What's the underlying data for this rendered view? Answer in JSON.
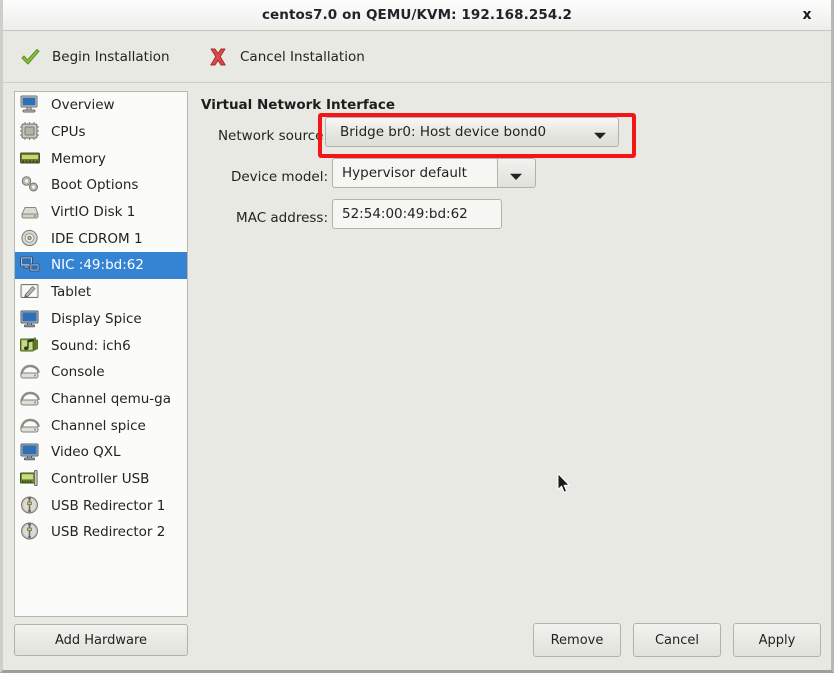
{
  "window": {
    "title": "centos7.0 on QEMU/KVM: 192.168.254.2",
    "close_label": "x"
  },
  "toolbar": {
    "items": [
      {
        "label": "Begin Installation",
        "icon": "check-icon"
      },
      {
        "label": "Cancel Installation",
        "icon": "x-mark-icon"
      }
    ]
  },
  "sidebar": {
    "items": [
      {
        "label": "Overview",
        "icon": "monitor-icon",
        "selected": false
      },
      {
        "label": "CPUs",
        "icon": "cpu-chip-icon",
        "selected": false
      },
      {
        "label": "Memory",
        "icon": "memory-icon",
        "selected": false
      },
      {
        "label": "Boot Options",
        "icon": "gears-icon",
        "selected": false
      },
      {
        "label": "VirtIO Disk 1",
        "icon": "hard-disk-icon",
        "selected": false
      },
      {
        "label": "IDE CDROM 1",
        "icon": "cdrom-icon",
        "selected": false
      },
      {
        "label": "NIC :49:bd:62",
        "icon": "network-card-icon",
        "selected": true
      },
      {
        "label": "Tablet",
        "icon": "tablet-pen-icon",
        "selected": false
      },
      {
        "label": "Display Spice",
        "icon": "display-icon",
        "selected": false
      },
      {
        "label": "Sound: ich6",
        "icon": "sound-note-icon",
        "selected": false
      },
      {
        "label": "Console",
        "icon": "console-icon",
        "selected": false
      },
      {
        "label": "Channel qemu-ga",
        "icon": "console-icon",
        "selected": false
      },
      {
        "label": "Channel spice",
        "icon": "console-icon",
        "selected": false
      },
      {
        "label": "Video QXL",
        "icon": "display-icon",
        "selected": false
      },
      {
        "label": "Controller USB",
        "icon": "controller-card-icon",
        "selected": false
      },
      {
        "label": "USB Redirector 1",
        "icon": "usb-icon",
        "selected": false
      },
      {
        "label": "USB Redirector 2",
        "icon": "usb-icon",
        "selected": false
      }
    ],
    "add_hardware_label": "Add Hardware"
  },
  "main": {
    "section_title": "Virtual Network Interface",
    "fields": {
      "network_source": {
        "label": "Network source:",
        "value": "Bridge br0: Host device bond0",
        "highlighted": true
      },
      "device_model": {
        "label": "Device model:",
        "value": "Hypervisor default"
      },
      "mac_address": {
        "label": "MAC address:",
        "value": "52:54:00:49:bd:62"
      }
    }
  },
  "footer": {
    "buttons": [
      {
        "label": "Remove"
      },
      {
        "label": "Cancel"
      },
      {
        "label": "Apply"
      }
    ]
  },
  "colors": {
    "selection_blue": "#3584d3",
    "highlight_red": "#f41616",
    "window_bg": "#e9e9e3",
    "list_bg": "#fbfbfa"
  }
}
